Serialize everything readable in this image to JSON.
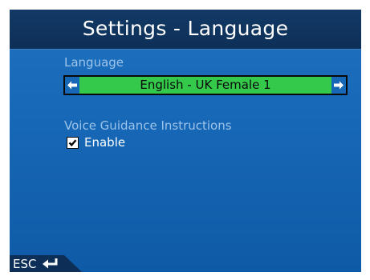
{
  "header": {
    "title": "Settings - Language"
  },
  "language": {
    "label": "Language",
    "selected_value": "English - UK Female 1"
  },
  "voice_guidance": {
    "label": "Voice Guidance Instructions",
    "enable_label": "Enable",
    "enable_checked": true
  },
  "footer": {
    "esc_label": "ESC"
  },
  "icons": {
    "previous": "left-arrow-icon",
    "next": "right-arrow-icon",
    "back": "return-arrow-icon",
    "check": "checkmark-icon"
  },
  "colors": {
    "title_bar": "#0d2f57",
    "background": "#1667b6",
    "section_label": "#9dc4ea",
    "selector": "#35c94b"
  }
}
